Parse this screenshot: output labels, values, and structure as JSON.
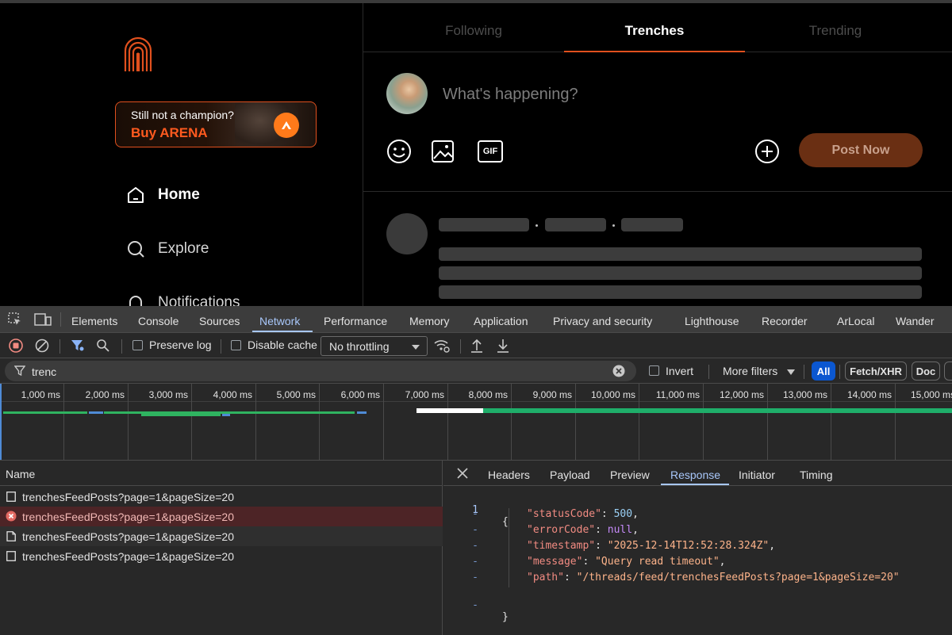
{
  "app": {
    "promo": {
      "line1": "Still not a champion?",
      "line2": "Buy ARENA"
    },
    "nav": [
      {
        "label": "Home",
        "icon": "home-icon"
      },
      {
        "label": "Explore",
        "icon": "search-icon"
      },
      {
        "label": "Notifications",
        "icon": "bell-icon"
      }
    ],
    "tabs": [
      "Following",
      "Trenches",
      "Trending"
    ],
    "active_tab": "Trenches",
    "composer": {
      "placeholder": "What's happening?",
      "gif_label": "GIF",
      "post_button": "Post Now"
    },
    "colors": {
      "accent": "#e0501e",
      "post_button_bg": "#6a2f13"
    }
  },
  "devtools": {
    "tabs": [
      "Elements",
      "Console",
      "Sources",
      "Network",
      "Performance",
      "Memory",
      "Application",
      "Privacy and security",
      "Lighthouse",
      "Recorder",
      "ArLocal",
      "Wander"
    ],
    "active_tab": "Network",
    "toolbar": {
      "preserve_log": "Preserve log",
      "disable_cache": "Disable cache",
      "throttling": "No throttling"
    },
    "filter": {
      "value": "trenc",
      "invert": "Invert",
      "more_filters": "More filters",
      "type_pills": [
        "All",
        "Fetch/XHR",
        "Doc"
      ]
    },
    "timeline": {
      "ticks": [
        "1,000 ms",
        "2,000 ms",
        "3,000 ms",
        "4,000 ms",
        "5,000 ms",
        "6,000 ms",
        "7,000 ms",
        "8,000 ms",
        "9,000 ms",
        "10,000 ms",
        "11,000 ms",
        "12,000 ms",
        "13,000 ms",
        "14,000 ms",
        "15,000 ms"
      ]
    },
    "requests": {
      "header": "Name",
      "rows": [
        {
          "name": "trenchesFeedPosts?page=1&pageSize=20",
          "status": "normal"
        },
        {
          "name": "trenchesFeedPosts?page=1&pageSize=20",
          "status": "error"
        },
        {
          "name": "trenchesFeedPosts?page=1&pageSize=20",
          "status": "doc"
        },
        {
          "name": "trenchesFeedPosts?page=1&pageSize=20",
          "status": "normal"
        }
      ]
    },
    "details": {
      "tabs": [
        "Headers",
        "Payload",
        "Preview",
        "Response",
        "Initiator",
        "Timing"
      ],
      "active_tab": "Response",
      "response": {
        "line_number": "1",
        "fold_marker": "-",
        "open_brace": "{",
        "close_brace": "}",
        "fields": [
          {
            "key": "\"statusCode\"",
            "value": "500",
            "kind": "number",
            "comma": ","
          },
          {
            "key": "\"errorCode\"",
            "value": "null",
            "kind": "keyword",
            "comma": ","
          },
          {
            "key": "\"timestamp\"",
            "value": "\"2025-12-14T12:52:28.324Z\"",
            "kind": "string",
            "comma": ","
          },
          {
            "key": "\"message\"",
            "value": "\"Query read timeout\"",
            "kind": "string",
            "comma": ","
          },
          {
            "key": "\"path\"",
            "value": "\"/threads/feed/trenchesFeedPosts?page=1&pageSize=20\"",
            "kind": "string",
            "comma": ""
          }
        ]
      }
    }
  }
}
